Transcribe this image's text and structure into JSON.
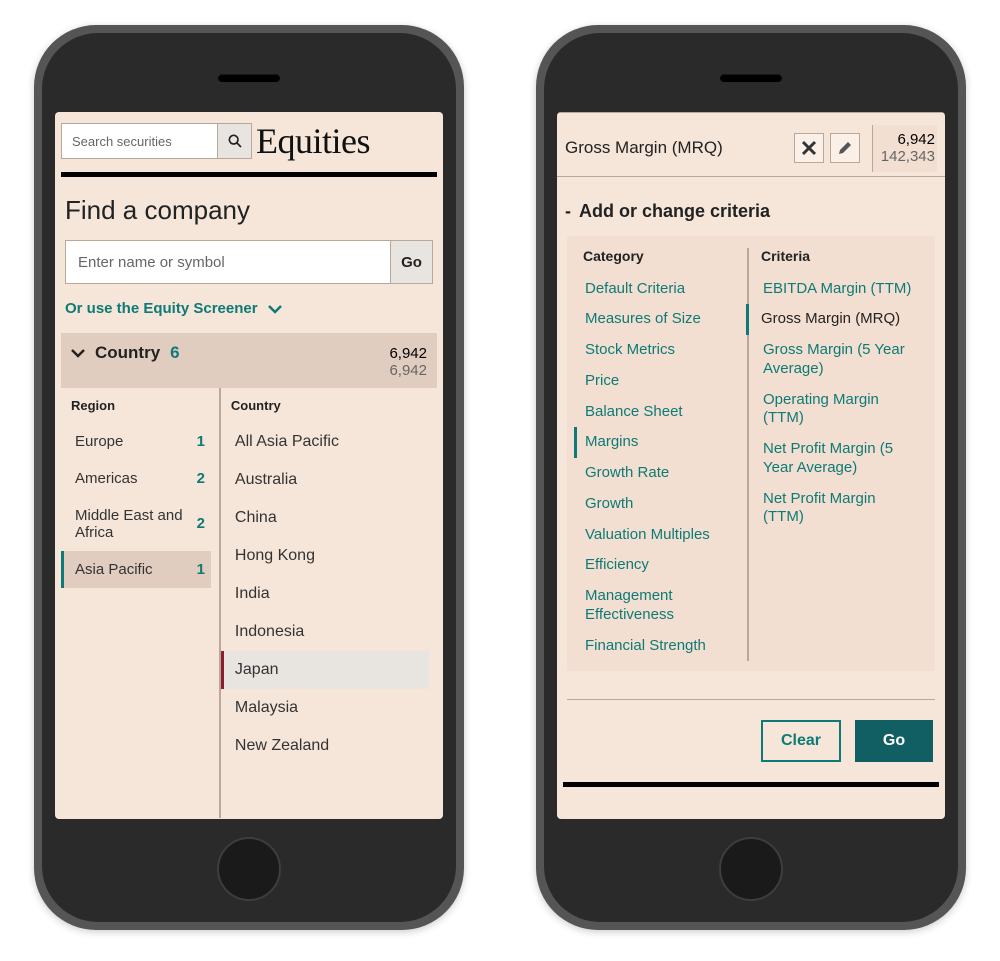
{
  "left": {
    "search_placeholder": "Search securities",
    "title": "Equities",
    "find_heading": "Find a company",
    "name_placeholder": "Enter name or symbol",
    "go_label": "Go",
    "screener_link": "Or use the Equity Screener",
    "country_section": {
      "label": "Country",
      "count": "6",
      "primary": "6,942",
      "secondary": "6,942"
    },
    "region_heading": "Region",
    "country_heading": "Country",
    "regions": [
      {
        "label": "Europe",
        "count": "1",
        "selected": false
      },
      {
        "label": "Americas",
        "count": "2",
        "selected": false
      },
      {
        "label": "Middle East and Africa",
        "count": "2",
        "selected": false
      },
      {
        "label": "Asia Pacific",
        "count": "1",
        "selected": true
      }
    ],
    "countries": [
      {
        "label": "All Asia Pacific",
        "selected": false
      },
      {
        "label": "Australia",
        "selected": false
      },
      {
        "label": "China",
        "selected": false
      },
      {
        "label": "Hong Kong",
        "selected": false
      },
      {
        "label": "India",
        "selected": false
      },
      {
        "label": "Indonesia",
        "selected": false
      },
      {
        "label": "Japan",
        "selected": true
      },
      {
        "label": "Malaysia",
        "selected": false
      },
      {
        "label": "New Zealand",
        "selected": false
      }
    ]
  },
  "right": {
    "active_criteria": {
      "name": "Gross Margin (MRQ)",
      "primary": "6,942",
      "secondary": "142,343"
    },
    "add_change_label": "Add or change criteria",
    "category_heading": "Category",
    "criteria_heading": "Criteria",
    "categories": [
      {
        "label": "Default Criteria",
        "selected": false
      },
      {
        "label": "Measures of Size",
        "selected": false
      },
      {
        "label": "Stock Metrics",
        "selected": false
      },
      {
        "label": "Price",
        "selected": false
      },
      {
        "label": "Balance Sheet",
        "selected": false
      },
      {
        "label": "Margins",
        "selected": true
      },
      {
        "label": "Growth Rate",
        "selected": false
      },
      {
        "label": "Growth",
        "selected": false
      },
      {
        "label": "Valuation Multiples",
        "selected": false
      },
      {
        "label": "Efficiency",
        "selected": false
      },
      {
        "label": "Management Effectiveness",
        "selected": false
      },
      {
        "label": "Financial Strength",
        "selected": false
      }
    ],
    "criteria": [
      {
        "label": "EBITDA Margin (TTM)",
        "selected": false
      },
      {
        "label": "Gross Margin (MRQ)",
        "selected": true
      },
      {
        "label": "Gross Margin (5 Year Average)",
        "selected": false
      },
      {
        "label": "Operating Margin (TTM)",
        "selected": false
      },
      {
        "label": "Net Profit Margin (5 Year Average)",
        "selected": false
      },
      {
        "label": "Net Profit Margin (TTM)",
        "selected": false
      }
    ],
    "clear_label": "Clear",
    "go_label": "Go"
  }
}
